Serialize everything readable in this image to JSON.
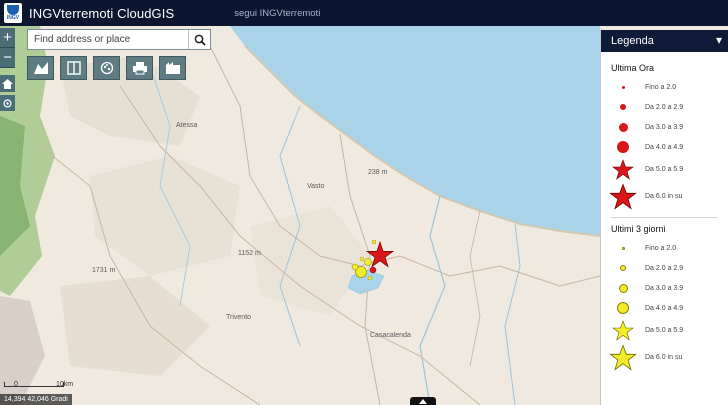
{
  "header": {
    "title": "INGVterremoti CloudGIS",
    "follow_link": "segui INGVterremoti",
    "logo_text": "INGV"
  },
  "search": {
    "placeholder": "Find address or place"
  },
  "tools": [
    "basemap-icon",
    "layers-icon",
    "share-icon",
    "print-icon",
    "gallery-icon"
  ],
  "map": {
    "place_labels": [
      "Vasto",
      "Atessa",
      "Trivento",
      "Casacalenda",
      "1731 m",
      "1152 m",
      "238 m"
    ],
    "legend_sections": []
  },
  "legend": {
    "title": "Legenda",
    "sections": [
      {
        "title": "Ultima Ora",
        "color": "#d9171a",
        "items": [
          {
            "label": "Fino a 2.0",
            "symbol": "dot"
          },
          {
            "label": "Da 2.0 a 2.9",
            "symbol": "dot"
          },
          {
            "label": "Da 3.0 a 3.9",
            "symbol": "dot"
          },
          {
            "label": "Da 4.0 a 4.9",
            "symbol": "dot"
          },
          {
            "label": "Da 5.0 a 5.9",
            "symbol": "star"
          },
          {
            "label": "Da 6.0 in su",
            "symbol": "star"
          }
        ]
      },
      {
        "title": "Ultimi 3 giorni",
        "color": "#f2ec2a",
        "items": [
          {
            "label": "Fino a 2.0",
            "symbol": "dot"
          },
          {
            "label": "Da 2.0 a 2.9",
            "symbol": "dot"
          },
          {
            "label": "Da 3.0 a 3.9",
            "symbol": "dot"
          },
          {
            "label": "Da 4.0 a 4.9",
            "symbol": "dot"
          },
          {
            "label": "Da 5.0 a 5.9",
            "symbol": "star"
          },
          {
            "label": "Da 6.0 in su",
            "symbol": "star"
          }
        ]
      }
    ]
  },
  "scale": {
    "left": "0",
    "right": "10km"
  },
  "coords": "14,394 42,046 Gradi",
  "colors": {
    "header": "#0c1630",
    "sea": "#a9d3e8",
    "land": "#efe9e0",
    "quake_recent": "#d9171a",
    "quake_3days": "#f2ec2a"
  }
}
